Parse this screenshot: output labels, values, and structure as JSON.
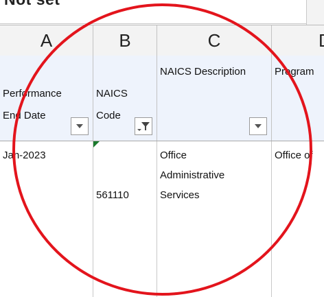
{
  "name_box": {
    "value": "Not set"
  },
  "columns": [
    {
      "letter": "A",
      "header": "Performance\nEnd Date",
      "filter_icon": "dropdown-arrow-icon",
      "value": "Jan-2023"
    },
    {
      "letter": "B",
      "header": "NAICS\nCode",
      "filter_icon": "filter-active-icon",
      "value": "561110"
    },
    {
      "letter": "C",
      "header": "NAICS Description",
      "filter_icon": "dropdown-arrow-icon",
      "value": "Office\nAdministrative\nServices"
    },
    {
      "letter": "D",
      "header": "Program",
      "filter_icon": "",
      "value": "Office of"
    }
  ],
  "colors": {
    "header_fill": "#eef3fc",
    "annotation_circle": "#e3141c",
    "error_indicator": "#1a7a2c"
  }
}
